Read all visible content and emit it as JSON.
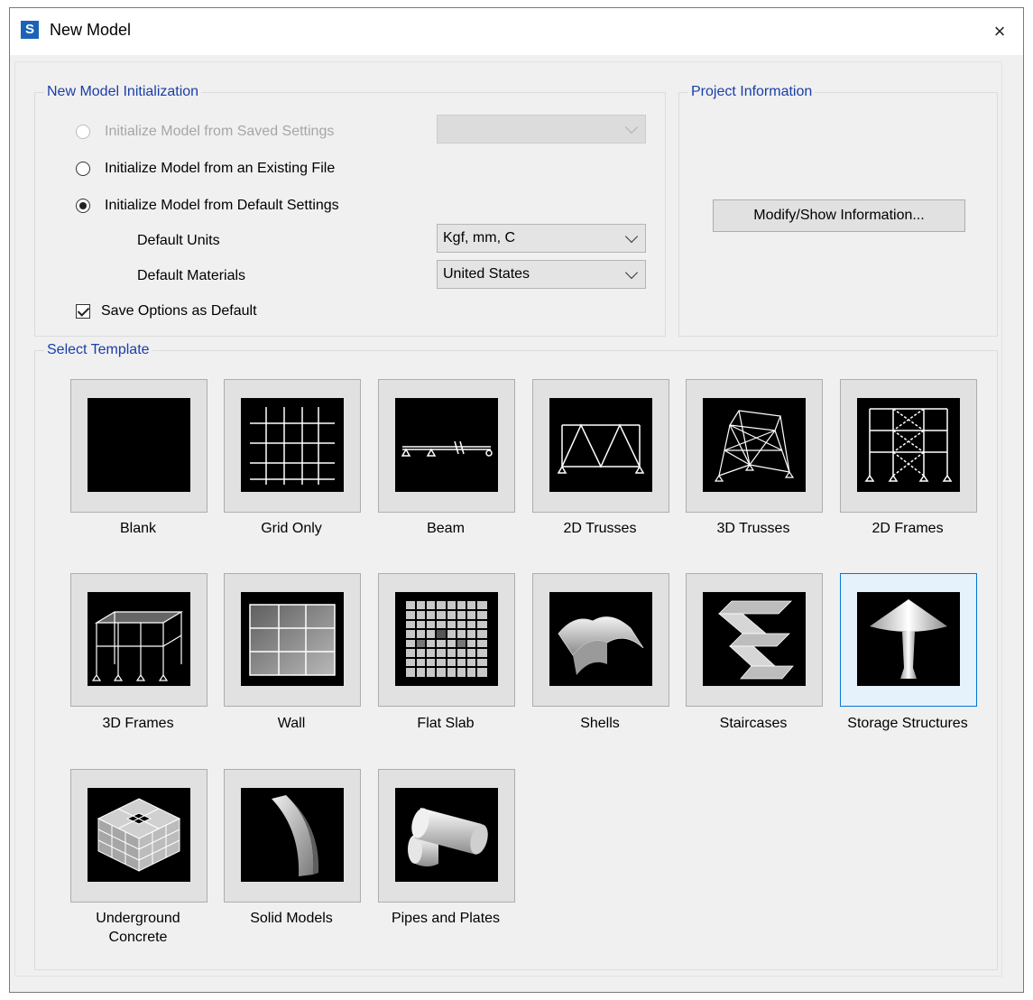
{
  "window": {
    "title": "New Model",
    "close_glyph": "×",
    "app_icon_letter": "S"
  },
  "init": {
    "legend": "New Model Initialization",
    "options": [
      {
        "label": "Initialize Model from Saved Settings",
        "enabled": false,
        "selected": false
      },
      {
        "label": "Initialize Model from an Existing File",
        "enabled": true,
        "selected": false
      },
      {
        "label": "Initialize Model from Default Settings",
        "enabled": true,
        "selected": true
      }
    ],
    "saved_settings_value": "",
    "default_units_label": "Default Units",
    "default_units_value": "Kgf, mm, C",
    "default_materials_label": "Default Materials",
    "default_materials_value": "United States",
    "save_default_label": "Save Options as Default",
    "save_default_checked": true
  },
  "project": {
    "legend": "Project Information",
    "modify_button": "Modify/Show Information..."
  },
  "templates": {
    "legend": "Select Template",
    "selected": "Storage Structures",
    "items": [
      {
        "label": "Blank",
        "icon": "blank-icon"
      },
      {
        "label": "Grid Only",
        "icon": "grid-icon"
      },
      {
        "label": "Beam",
        "icon": "beam-icon"
      },
      {
        "label": "2D Trusses",
        "icon": "truss-2d-icon"
      },
      {
        "label": "3D Trusses",
        "icon": "truss-3d-icon"
      },
      {
        "label": "2D Frames",
        "icon": "frame-2d-icon"
      },
      {
        "label": "3D Frames",
        "icon": "frame-3d-icon"
      },
      {
        "label": "Wall",
        "icon": "wall-icon"
      },
      {
        "label": "Flat Slab",
        "icon": "flat-slab-icon"
      },
      {
        "label": "Shells",
        "icon": "shells-icon"
      },
      {
        "label": "Staircases",
        "icon": "staircase-icon"
      },
      {
        "label": "Storage Structures",
        "icon": "storage-structure-icon"
      },
      {
        "label": "Underground\nConcrete",
        "icon": "underground-concrete-icon"
      },
      {
        "label": "Solid Models",
        "icon": "solid-model-icon"
      },
      {
        "label": "Pipes and Plates",
        "icon": "pipe-icon"
      }
    ]
  },
  "colors": {
    "accent": "#0078d7",
    "legend": "#1a3ea8",
    "app_icon": "#1b64b5"
  }
}
